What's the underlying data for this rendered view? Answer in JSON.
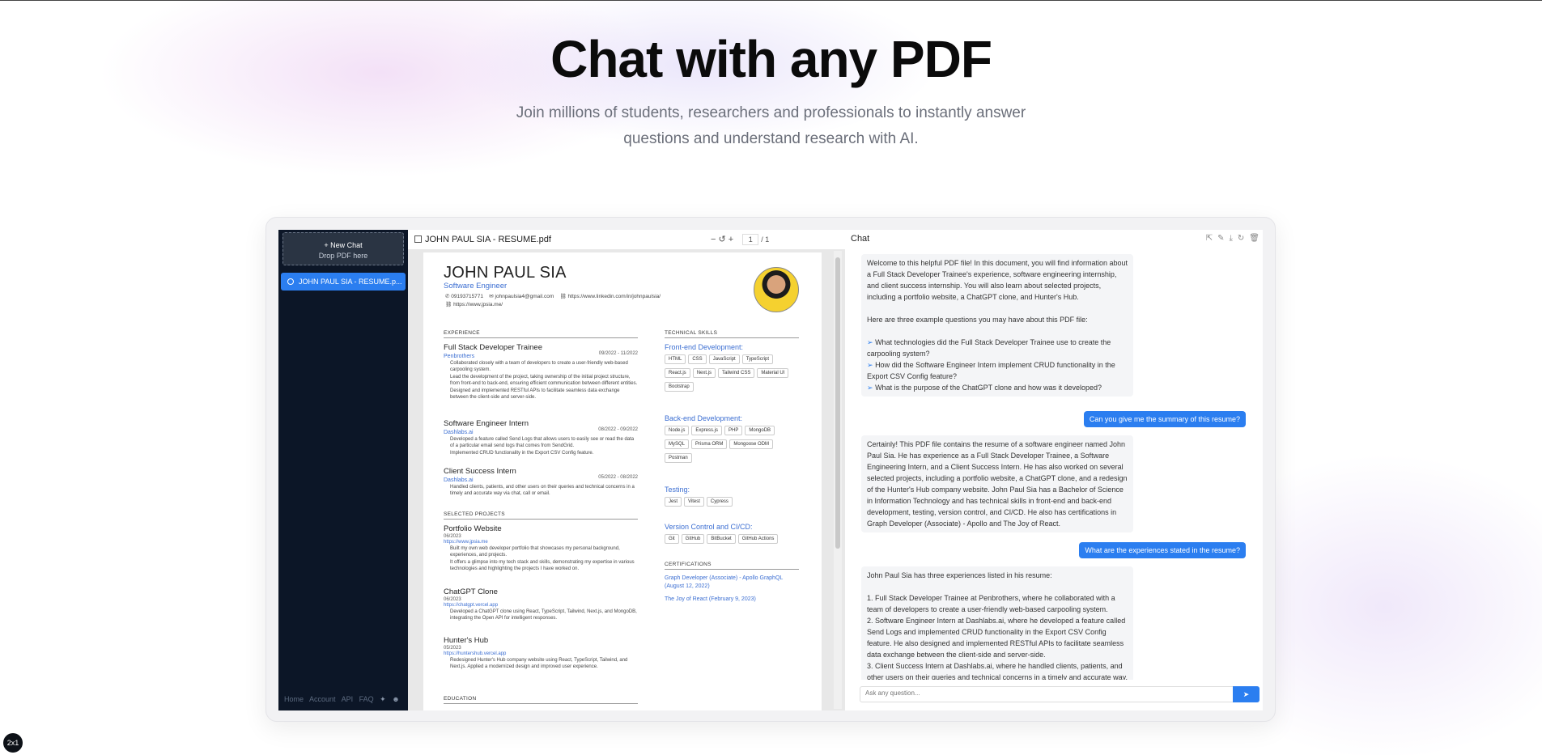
{
  "hero": {
    "title": "Chat with any PDF",
    "subtitle": "Join millions of students, researchers and professionals to instantly answer questions and understand research with AI."
  },
  "sidebar": {
    "new_chat": "+ New Chat",
    "drop": "Drop PDF here",
    "chat_item": "JOHN PAUL SIA - RESUME.p...",
    "footer": [
      "Home",
      "Account",
      "API",
      "FAQ"
    ]
  },
  "pdf": {
    "filename": "JOHN PAUL SIA - RESUME.pdf",
    "page_input": "1",
    "page_total": "/ 1",
    "name": "JOHN PAUL SIA",
    "role": "Software Engineer",
    "contact": {
      "phone": "09193715771",
      "email": "johnpaulsia4@gmail.com",
      "linkedin": "https://www.linkedin.com/in/johnpaulsia/",
      "site": "https://www.jpsia.me/"
    },
    "sections": {
      "experience": "EXPERIENCE",
      "projects": "SELECTED PROJECTS",
      "education": "EDUCATION",
      "skills": "TECHNICAL SKILLS",
      "certs": "CERTIFICATIONS"
    },
    "jobs": [
      {
        "title": "Full Stack Developer Trainee",
        "company": "Penbrothers",
        "date": "09/2022 - 11/2022",
        "bullets": [
          "Collaborated closely with a team of developers to create a user-friendly web-based carpooling system.",
          "Lead the development of the project, taking ownership of the initial project structure, from front-end to back-end, ensuring efficient communication between different entities.",
          "Designed and implemented RESTful APIs to facilitate seamless data exchange between the client-side and server-side."
        ]
      },
      {
        "title": "Software Engineer Intern",
        "company": "Dashlabs.ai",
        "date": "08/2022 - 09/2022",
        "bullets": [
          "Developed a feature called Send Logs that allows users to easily see or read the data of a particular email send logs that comes from SendGrid.",
          "Implemented CRUD functionality in the Export CSV Config feature."
        ]
      },
      {
        "title": "Client Success Intern",
        "company": "Dashlabs.ai",
        "date": "05/2022 - 08/2022",
        "bullets": [
          "Handled clients, patients, and other users on their queries and technical concerns in a timely and accurate way via chat, call or email."
        ]
      }
    ],
    "projects": [
      {
        "title": "Portfolio Website",
        "date": "06/2023",
        "link": "https://www.jpsia.me",
        "bullets": [
          "Built my own web developer portfolio that showcases my personal background, experiences, and projects.",
          "It offers a glimpse into my tech stack and skills, demonstrating my expertise in various technologies and highlighting the projects I have worked on."
        ]
      },
      {
        "title": "ChatGPT Clone",
        "date": "06/2023",
        "link": "https://chatgpt.vercel.app",
        "bullets": [
          "Developed a ChatGPT clone using React, TypeScript, Tailwind, Next.js, and MongoDB, integrating the Open API for intelligent responses."
        ]
      },
      {
        "title": "Hunter's Hub",
        "date": "05/2023",
        "link": "https://huntershub.vercel.app",
        "bullets": [
          "Redesigned Hunter's Hub company website using React, TypeScript, Tailwind, and Next.js. Applied a modernized design and improved user experience."
        ]
      }
    ],
    "skills": [
      {
        "heading": "Front-end Development:",
        "tags": [
          "HTML",
          "CSS",
          "JavaScript",
          "TypeScript",
          "React.js",
          "Next.js",
          "Tailwind CSS",
          "Material UI",
          "Bootstrap"
        ]
      },
      {
        "heading": "Back-end Development:",
        "tags": [
          "Node.js",
          "Express.js",
          "PHP",
          "MongoDB",
          "MySQL",
          "Prisma ORM",
          "Mongoose ODM",
          "Postman"
        ]
      },
      {
        "heading": "Testing:",
        "tags": [
          "Jest",
          "Vitest",
          "Cypress"
        ]
      },
      {
        "heading": "Version Control and CI/CD:",
        "tags": [
          "Git",
          "GitHub",
          "BitBucket",
          "GitHub Actions"
        ]
      }
    ],
    "certs": [
      "Graph Developer (Associate) - Apollo GraphQL (August 12, 2022)",
      "The Joy of React (February 9, 2023)"
    ]
  },
  "chat": {
    "header": "Chat",
    "welcome": "Welcome to this helpful PDF file! In this document, you will find information about a Full Stack Developer Trainee's experience, software engineering internship, and client success internship. You will also learn about selected projects, including a portfolio website, a ChatGPT clone, and Hunter's Hub.",
    "examples_intro": "Here are three example questions you may have about this PDF file:",
    "examples": [
      "What technologies did the Full Stack Developer Trainee use to create the carpooling system?",
      "How did the Software Engineer Intern implement CRUD functionality in the Export CSV Config feature?",
      "What is the purpose of the ChatGPT clone and how was it developed?"
    ],
    "user1": "Can you give me the summary of this resume?",
    "answer1": "Certainly! This PDF file contains the resume of a software engineer named John Paul Sia. He has experience as a Full Stack Developer Trainee, a Software Engineering Intern, and a Client Success Intern. He has also worked on several selected projects, including a portfolio website, a ChatGPT clone, and a redesign of the Hunter's Hub company website. John Paul Sia has a Bachelor of Science in Information Technology and has technical skills in front-end and back-end development, testing, version control, and CI/CD. He also has certifications in Graph Developer (Associate) - Apollo and The Joy of React.",
    "user2": "What are the experiences stated in the resume?",
    "answer2_intro": "John Paul Sia has three experiences listed in his resume:",
    "answer2_items": [
      "1. Full Stack Developer Trainee at Penbrothers, where he collaborated with a team of developers to create a user-friendly web-based carpooling system.",
      "2. Software Engineer Intern at Dashlabs.ai, where he developed a feature called Send Logs and implemented CRUD functionality in the Export CSV Config feature. He also designed and implemented RESTful APIs to facilitate seamless data exchange between the client-side and server-side.",
      "3. Client Success Intern at Dashlabs.ai, where he handled clients, patients, and other users on their queries and technical concerns in a timely and accurate way."
    ],
    "placeholder": "Ask any question...",
    "send": "➤"
  },
  "badge": "2x1"
}
